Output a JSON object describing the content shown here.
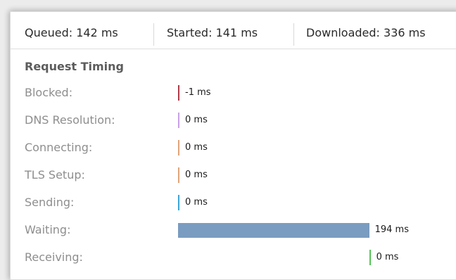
{
  "summary": {
    "queued": "Queued: 142 ms",
    "started": "Started: 141 ms",
    "downloaded": "Downloaded: 336 ms"
  },
  "request_timing": {
    "title": "Request Timing",
    "rows": [
      {
        "label": "Blocked:",
        "value": "-1 ms",
        "ms": -1,
        "color": "#b03a48"
      },
      {
        "label": "DNS Resolution:",
        "value": "0 ms",
        "ms": 0,
        "color": "#c9a0e8"
      },
      {
        "label": "Connecting:",
        "value": "0 ms",
        "ms": 0,
        "color": "#e0a47a"
      },
      {
        "label": "TLS Setup:",
        "value": "0 ms",
        "ms": 0,
        "color": "#e0a47a"
      },
      {
        "label": "Sending:",
        "value": "0 ms",
        "ms": 0,
        "color": "#3aa6d8"
      },
      {
        "label": "Waiting:",
        "value": "194 ms",
        "ms": 194,
        "color": "#7a9cc0"
      },
      {
        "label": "Receiving:",
        "value": "0 ms",
        "ms": 0,
        "color": "#56c456"
      }
    ]
  }
}
